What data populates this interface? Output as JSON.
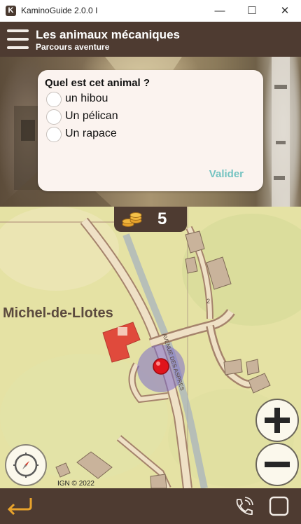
{
  "window": {
    "app_initial": "K",
    "title": "KaminoGuide 2.0.0 I",
    "minimize_glyph": "—",
    "maximize_glyph": "☐",
    "close_glyph": "✕"
  },
  "header": {
    "title": "Les animaux mécaniques",
    "subtitle": "Parcours aventure",
    "menu_icon": "hamburger-menu-icon"
  },
  "quiz": {
    "question": "Quel est cet animal ?",
    "options": [
      {
        "label": "un hibou",
        "selected": false
      },
      {
        "label": "Un pélican",
        "selected": false
      },
      {
        "label": "Un rapace",
        "selected": false
      }
    ],
    "submit_label": "Valider",
    "submit_color": "#74c3c1"
  },
  "coins": {
    "icon": "coin-stack-icon",
    "count": "5"
  },
  "map": {
    "place_label": "Michel-de-Llotes",
    "street_label": "AVENUE DES ASPRES",
    "road_number": "2",
    "attribution": "IGN © 2022",
    "zoom_in_icon": "plus-icon",
    "zoom_out_icon": "minus-icon",
    "compass_icon": "compass-icon"
  },
  "footer": {
    "back_icon": "back-arrow-icon",
    "call_icon": "phone-icon",
    "square_icon": "square-icon"
  },
  "colors": {
    "brand_brown": "#4e3b31",
    "card_bg": "#fbf3ef",
    "accent": "#e8a32c",
    "map_bg": "#e6e3a6"
  }
}
